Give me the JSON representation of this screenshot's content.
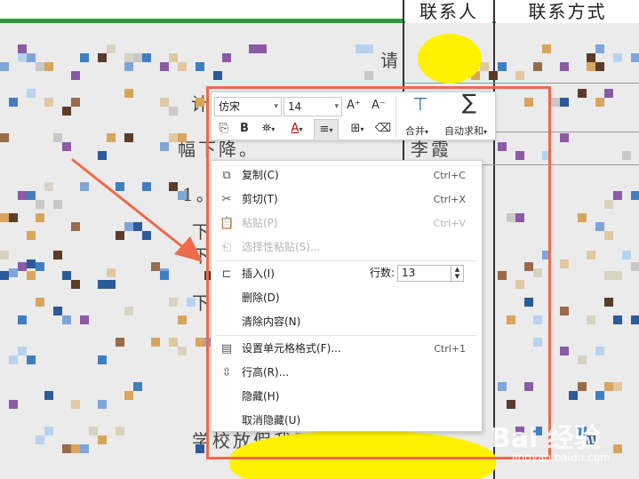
{
  "sheet": {
    "col_headers": [
      "联系人",
      "联系方式"
    ],
    "bg_texts": [
      "请",
      "计",
      "幅下降。",
      "1。",
      "下",
      "下",
      "下",
      "李霞",
      "学校放假我不人。"
    ]
  },
  "toolbar": {
    "font_name": "仿宋",
    "font_size": "14",
    "grow_font": "A⁺",
    "shrink_font": "A⁻",
    "bold": "B",
    "font_color_glyph": "A",
    "merge_label": "合并",
    "autosum_label": "自动求和"
  },
  "menu": {
    "items": [
      {
        "label": "复制(C)",
        "shortcut": "Ctrl+C",
        "icon": "copy-icon",
        "disabled": false
      },
      {
        "label": "剪切(T)",
        "shortcut": "Ctrl+X",
        "icon": "scissors-icon",
        "disabled": false
      },
      {
        "label": "粘贴(P)",
        "shortcut": "Ctrl+V",
        "icon": "paste-icon",
        "disabled": true
      },
      {
        "label": "选择性粘贴(S)...",
        "shortcut": "",
        "icon": "paste-special-icon",
        "disabled": true
      },
      {
        "label": "插入(I)",
        "shortcut": "",
        "icon": "insert-rows-icon",
        "disabled": false
      },
      {
        "label": "删除(D)",
        "shortcut": "",
        "icon": "",
        "disabled": false
      },
      {
        "label": "清除内容(N)",
        "shortcut": "",
        "icon": "",
        "disabled": false
      },
      {
        "label": "设置单元格格式(F)...",
        "shortcut": "Ctrl+1",
        "icon": "format-cells-icon",
        "disabled": false
      },
      {
        "label": "行高(R)...",
        "shortcut": "",
        "icon": "row-height-icon",
        "disabled": false
      },
      {
        "label": "隐藏(H)",
        "shortcut": "",
        "icon": "",
        "disabled": false
      },
      {
        "label": "取消隐藏(U)",
        "shortcut": "",
        "icon": "",
        "disabled": false
      }
    ],
    "row_count_label": "行数:",
    "row_count_value": "13"
  },
  "watermark": {
    "main": "Bai 经验",
    "sub": "jingyan.baidu.com"
  },
  "colors": {
    "highlight_box": "#ee6a4a",
    "arrow": "#ee6a4a",
    "header_line": "#2e9b3a",
    "marker": "#fff200"
  }
}
